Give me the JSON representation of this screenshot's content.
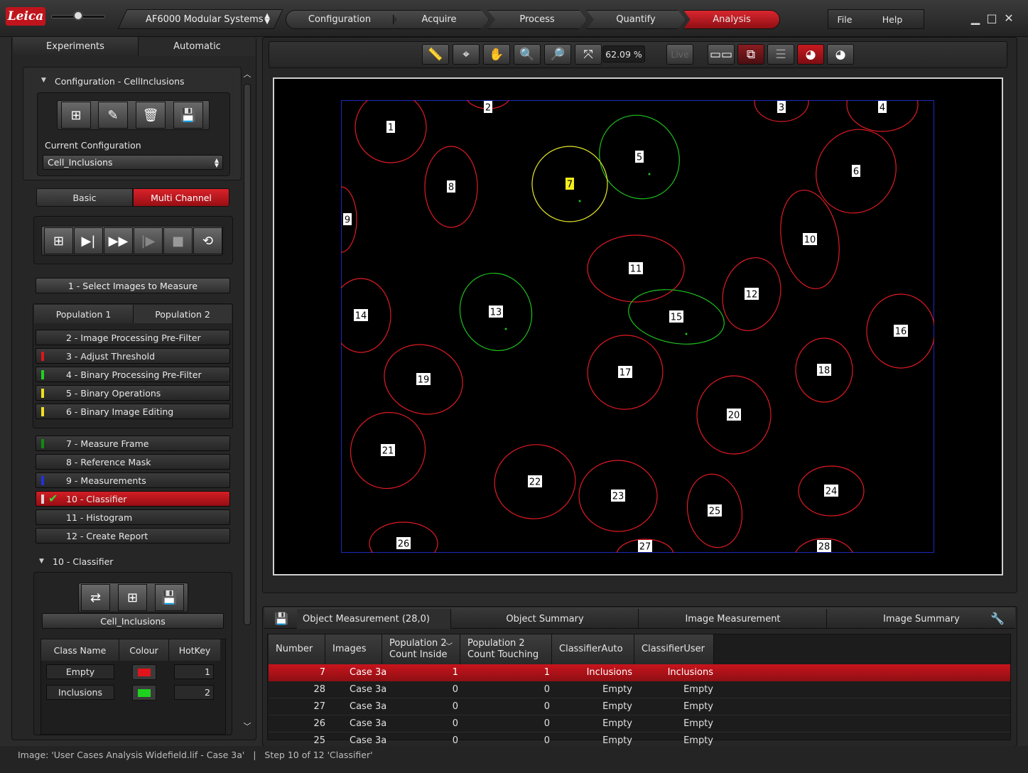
{
  "app": {
    "logo": "Leica",
    "system": "AF6000 Modular Systems",
    "workflow": [
      "Configuration",
      "Acquire",
      "Process",
      "Quantify",
      "Analysis"
    ],
    "menu": [
      "File",
      "Help"
    ],
    "window_icons": [
      "minimize-icon",
      "maximize-icon",
      "close-icon"
    ]
  },
  "left": {
    "tabs": [
      "Experiments",
      "Automatic"
    ],
    "config_header": "Configuration - CellInclusions",
    "current_config_label": "Current Configuration",
    "current_config_value": "Cell_Inclusions",
    "mode_tabs": [
      "Basic",
      "Multi Channel"
    ],
    "select_images": "1 - Select Images to Measure",
    "population_tabs": [
      "Population 1",
      "Population 2"
    ],
    "steps_a": [
      {
        "label": "2 - Image Processing Pre-Filter",
        "color": ""
      },
      {
        "label": "3 - Adjust Threshold",
        "color": "#e0141c"
      },
      {
        "label": "4 - Binary Processing Pre-Filter",
        "color": "#1fd21f"
      },
      {
        "label": "5 - Binary Operations",
        "color": "#f0e020"
      },
      {
        "label": "6 - Binary Image Editing",
        "color": "#f0e020"
      }
    ],
    "steps_b": [
      {
        "label": "7 - Measure Frame",
        "color": "#118a11"
      },
      {
        "label": "8 - Reference Mask",
        "color": ""
      },
      {
        "label": "9 - Measurements",
        "color": "#2030e0"
      },
      {
        "label": "10 - Classifier",
        "color": "#d8d8d8"
      },
      {
        "label": "11 - Histogram",
        "color": ""
      },
      {
        "label": "12 - Create Report",
        "color": ""
      }
    ],
    "classifier_header": "10 - Classifier",
    "classifier_name": "Cell_Inclusions",
    "class_columns": [
      "Class Name",
      "Colour",
      "HotKey"
    ],
    "classes": [
      {
        "name": "Empty",
        "colour": "#e0141c",
        "hotkey": "1"
      },
      {
        "name": "Inclusions",
        "colour": "#1fd21f",
        "hotkey": "2"
      }
    ]
  },
  "viewer": {
    "zoom": "62.09 %",
    "live": "Live",
    "cells": [
      {
        "id": "1",
        "status": "empty"
      },
      {
        "id": "2",
        "status": "empty"
      },
      {
        "id": "3",
        "status": "empty"
      },
      {
        "id": "4",
        "status": "empty"
      },
      {
        "id": "5",
        "status": "inclusions"
      },
      {
        "id": "6",
        "status": "empty"
      },
      {
        "id": "7",
        "status": "selected"
      },
      {
        "id": "8",
        "status": "empty"
      },
      {
        "id": "9",
        "status": "empty"
      },
      {
        "id": "10",
        "status": "empty"
      },
      {
        "id": "11",
        "status": "empty"
      },
      {
        "id": "12",
        "status": "empty"
      },
      {
        "id": "13",
        "status": "inclusions"
      },
      {
        "id": "14",
        "status": "empty"
      },
      {
        "id": "15",
        "status": "inclusions"
      },
      {
        "id": "16",
        "status": "empty"
      },
      {
        "id": "17",
        "status": "empty"
      },
      {
        "id": "18",
        "status": "empty"
      },
      {
        "id": "19",
        "status": "empty"
      },
      {
        "id": "20",
        "status": "empty"
      },
      {
        "id": "21",
        "status": "empty"
      },
      {
        "id": "22",
        "status": "empty"
      },
      {
        "id": "23",
        "status": "empty"
      },
      {
        "id": "24",
        "status": "empty"
      },
      {
        "id": "25",
        "status": "empty"
      },
      {
        "id": "26",
        "status": "empty"
      },
      {
        "id": "27",
        "status": "empty"
      },
      {
        "id": "28",
        "status": "empty"
      }
    ]
  },
  "results": {
    "tabs": [
      "Object Measurement (28,0)",
      "Object Summary",
      "Image Measurement",
      "Image Summary"
    ],
    "columns": [
      "Number",
      "Images",
      "Population 2 Count Inside",
      "Population 2 Count Touching",
      "ClassifierAuto",
      "ClassifierUser"
    ],
    "rows": [
      [
        "7",
        "Case 3a",
        "1",
        "1",
        "Inclusions",
        "Inclusions"
      ],
      [
        "28",
        "Case 3a",
        "0",
        "0",
        "Empty",
        "Empty"
      ],
      [
        "27",
        "Case 3a",
        "0",
        "0",
        "Empty",
        "Empty"
      ],
      [
        "26",
        "Case 3a",
        "0",
        "0",
        "Empty",
        "Empty"
      ],
      [
        "25",
        "Case 3a",
        "0",
        "0",
        "Empty",
        "Empty"
      ]
    ]
  },
  "status": "Image: 'User Cases Analysis Widefield.lif - Case 3a'   |   Step 10 of 12 'Classifier'"
}
